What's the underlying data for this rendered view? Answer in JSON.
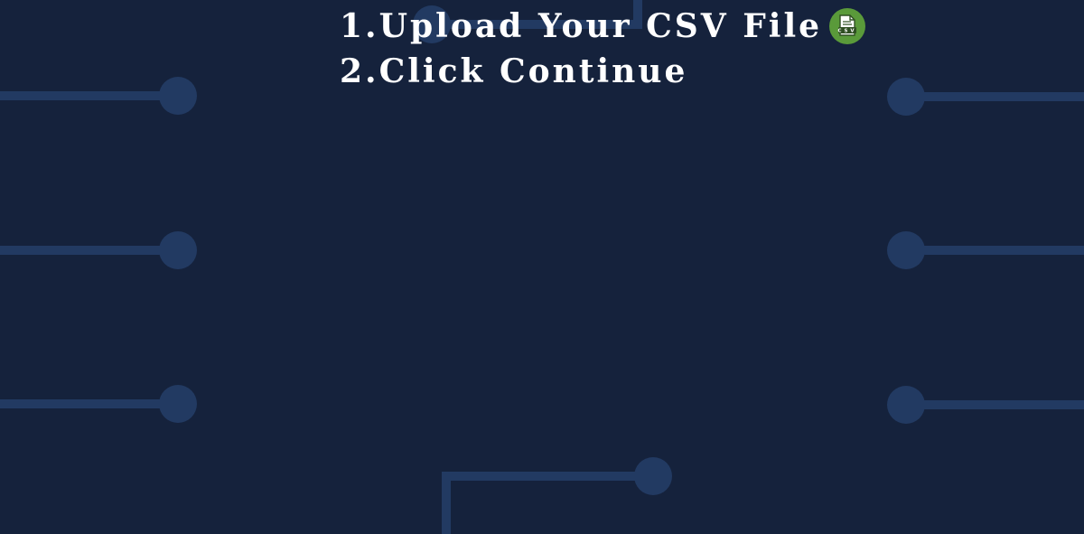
{
  "instructions": {
    "step1": {
      "number": "1.",
      "text": "Upload Your CSV File",
      "icon": "csv-file-icon",
      "icon_label": "CSV",
      "icon_color": "#5a9a3a"
    },
    "step2": {
      "number": "2.",
      "text": "Click Continue"
    }
  },
  "theme": {
    "background": "#15223c",
    "circuit_color": "#223a62",
    "text_color": "#ffffff"
  }
}
